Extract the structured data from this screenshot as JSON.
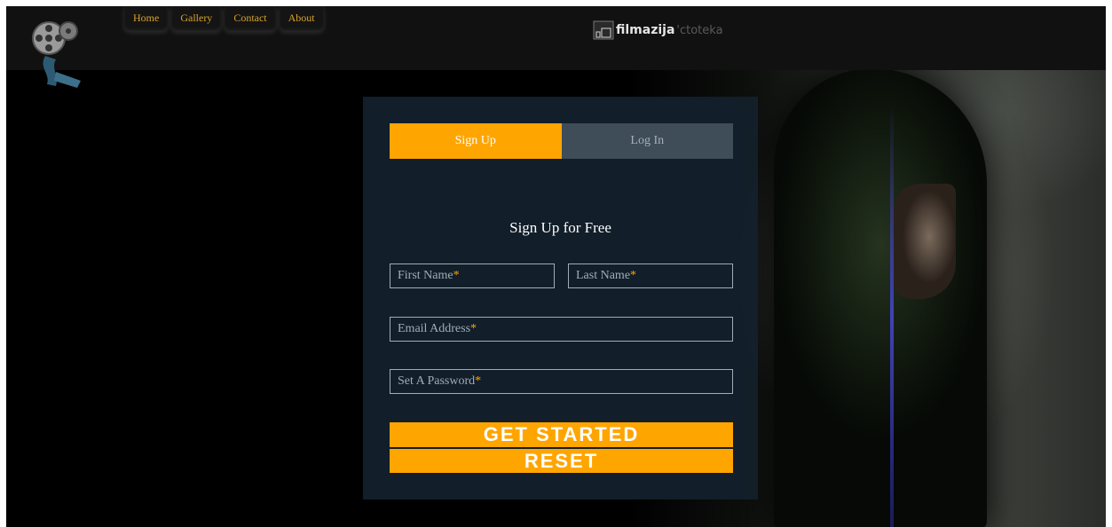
{
  "nav": {
    "items": [
      {
        "label": "Home"
      },
      {
        "label": "Gallery"
      },
      {
        "label": "Contact"
      },
      {
        "label": "About"
      }
    ]
  },
  "brand": {
    "name": "filmazija",
    "suffix": "'ctoteka",
    "logo_icon": "film-reel-icon"
  },
  "tabs": [
    {
      "label": "Sign Up",
      "active": true
    },
    {
      "label": "Log In",
      "active": false
    }
  ],
  "form": {
    "title": "Sign Up for Free",
    "first_name_placeholder": "First Name",
    "last_name_placeholder": "Last Name",
    "email_placeholder": "Email Address",
    "password_placeholder": "Set A Password",
    "required_marker": "*",
    "submit_label": "GET STARTED",
    "reset_label": "RESET"
  },
  "colors": {
    "accent": "#ffa500",
    "panel": "#13202c",
    "nav_text": "#d8a22a",
    "inactive_tab": "#3e4d58"
  }
}
